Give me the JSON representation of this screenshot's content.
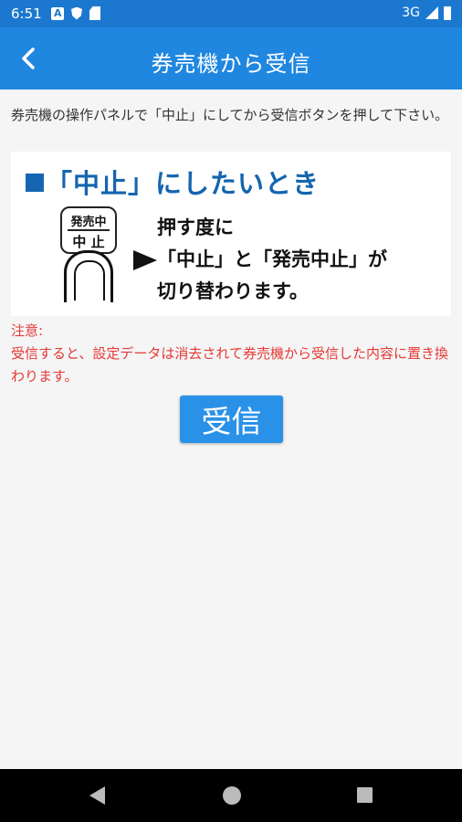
{
  "status_bar": {
    "time": "6:51",
    "network": "3G",
    "left_icons": [
      "a-badge-icon",
      "shield-icon",
      "sim-card-icon"
    ],
    "right_icons": [
      "signal-icon",
      "battery-icon"
    ]
  },
  "app_bar": {
    "title": "券売機から受信",
    "back_icon": "chevron-left-icon",
    "color": "#2087e0"
  },
  "instruction": "券売機の操作パネルで「中止」にしてから受信ボタンを押して下さい。",
  "illustration": {
    "heading": "「中止」にしたいとき",
    "button_label_top": "発売中",
    "button_label_bottom": "中 止",
    "description_lines": [
      "押す度に",
      "「中止」と「発売中止」が",
      "切り替わります。"
    ]
  },
  "warning": {
    "label": "注意:",
    "text": "受信すると、設定データは消去されて券売機から受信した内容に置き換わります。",
    "color": "#e53935"
  },
  "receive_button": {
    "label": "受信",
    "color": "#2a91e8"
  },
  "nav_bar": {
    "icons": [
      "nav-back-icon",
      "nav-home-icon",
      "nav-recents-icon"
    ]
  }
}
